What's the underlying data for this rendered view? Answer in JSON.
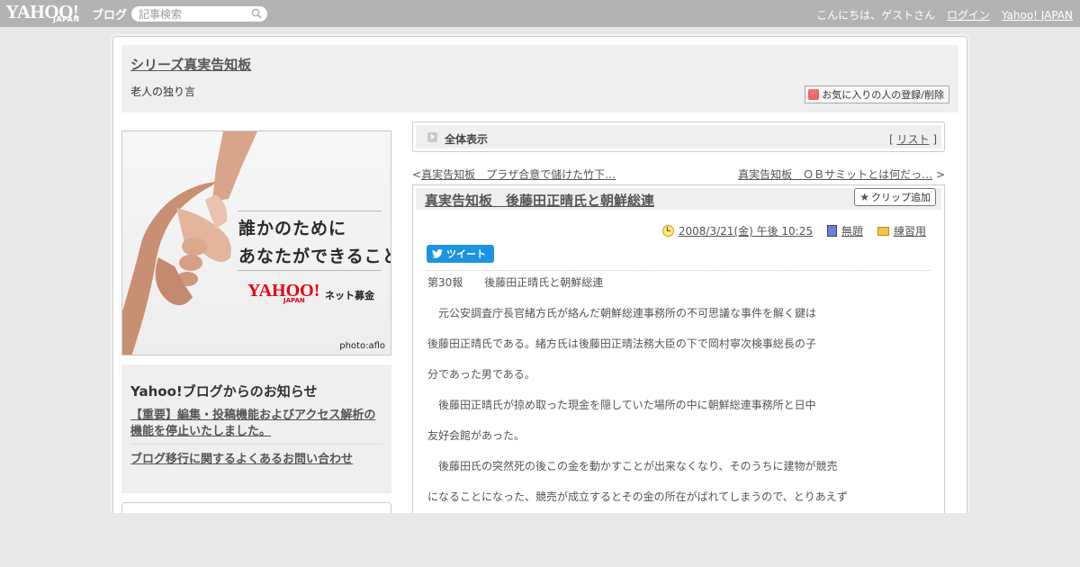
{
  "topbar": {
    "logo_text": "YAHOO!",
    "logo_japan": "JAPAN",
    "logo_blog": "ブログ",
    "search_placeholder": "記事検索",
    "greeting": "こんにちは、ゲストさん",
    "login_link": "ログイン",
    "yahoo_japan_link": "Yahoo! JAPAN"
  },
  "header": {
    "blog_title": "シリーズ真実告知板",
    "blog_description": "老人の独り言",
    "favorite_button": "お気に入りの人の登録/削除"
  },
  "banner": {
    "line1": "誰かのために",
    "line2": "あなたができること",
    "brand": "YAHOO!",
    "brand_japan": "JAPAN",
    "brand_sub": "ネット募金",
    "credit": "photo:aflo"
  },
  "notice": {
    "heading": "Yahoo!ブログからのお知らせ",
    "items": [
      "【重要】編集・投稿機能およびアクセス解析の機能を停止いたしました。",
      "ブログ移行に関するよくあるお問い合わせ"
    ]
  },
  "view_bar": {
    "label": "全体表示",
    "list_prefix": "[",
    "list_link": "リスト",
    "list_suffix": "]"
  },
  "navigation": {
    "prev_arrow": "<",
    "prev_title": "真実告知板　プラザ合意で儲けた竹下…",
    "next_title": "真実告知板　ＯＢサミットとは何だっ…",
    "next_arrow": ">"
  },
  "article": {
    "title": "真実告知板　後藤田正晴氏と朝鮮総連",
    "clip_button": "クリップ追加",
    "date": "2008/3/21(金) 午後 10:25",
    "category": "無題",
    "folder": "練習用",
    "tweet_button": "ツイート",
    "paragraphs": [
      "第30報　　後藤田正晴氏と朝鮮総連",
      "　元公安調査庁長官緒方氏が絡んだ朝鮮総連事務所の不可思議な事件を解く鍵は",
      "後藤田正晴氏である。緒方氏は後藤田正晴法務大臣の下で岡村寧次検事総長の子",
      "分であった男である。",
      "　後藤田正晴氏が掠め取った現金を隠していた場所の中に朝鮮総連事務所と日中",
      "友好会館があった。",
      "　後藤田氏の突然死の後この金を動かすことが出来なくなり、そのうちに建物が競売",
      "になることになった、競売が成立するとその金の所在がばれてしまうので、とりあえず"
    ]
  }
}
